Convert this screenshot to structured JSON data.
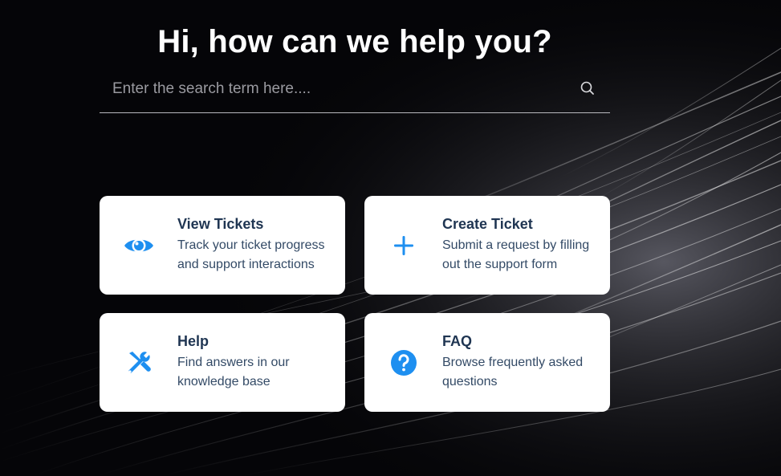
{
  "header": {
    "title": "Hi, how can we help you?"
  },
  "search": {
    "placeholder": "Enter the search term here....",
    "icon": "search-icon"
  },
  "cards": [
    {
      "title": "View Tickets",
      "description": "Track your ticket progress and support interactions",
      "icon": "eye-icon"
    },
    {
      "title": "Create Ticket",
      "description": "Submit a request by filling out the support form",
      "icon": "plus-icon"
    },
    {
      "title": "Help",
      "description": "Find answers in our knowledge base",
      "icon": "tools-icon"
    },
    {
      "title": "FAQ",
      "description": "Browse frequently asked questions",
      "icon": "question-circle-icon"
    }
  ],
  "colors": {
    "accent": "#1e8ff0",
    "card_title": "#1f3552",
    "card_text": "#334a66",
    "background": "#050508"
  }
}
